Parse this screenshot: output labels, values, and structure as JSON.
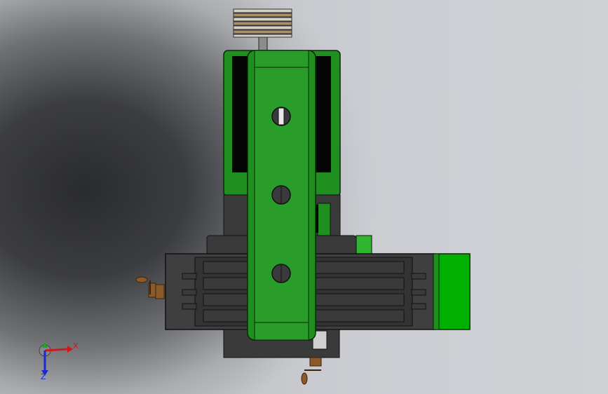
{
  "viewport": {
    "triad": {
      "x_label": "X",
      "z_label": "Z",
      "colors": {
        "x": "#d01818",
        "y": "#18a818",
        "z": "#1a2ad0"
      }
    }
  },
  "model": {
    "colors": {
      "green": "#1f8f1f",
      "green_light": "#2fb52f",
      "green_bright": "#00b000",
      "dark_body": "#3a3a3a",
      "black": "#050505",
      "bronze": "#8a5a2b"
    }
  }
}
